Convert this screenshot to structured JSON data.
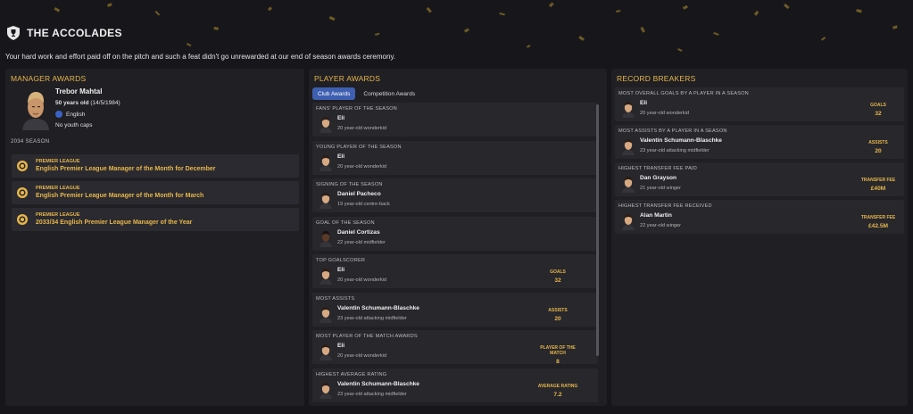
{
  "header": {
    "title": "THE ACCOLADES",
    "subtitle": "Your hard work and effort paid off on the pitch and such a feat didn't go unrewarded at our end of season awards ceremony."
  },
  "manager_awards": {
    "title": "MANAGER AWARDS",
    "name": "Trebor Mahtal",
    "age": "50 years old",
    "dob": "(14/5/1984)",
    "nationality": "English",
    "caps": "No youth caps",
    "season": "2034 SEASON",
    "awards": [
      {
        "competition": "PREMIER LEAGUE",
        "name": "English Premier League Manager of the Month for December"
      },
      {
        "competition": "PREMIER LEAGUE",
        "name": "English Premier League Manager of the Month for March"
      },
      {
        "competition": "PREMIER LEAGUE",
        "name": "2033/34 English Premier League Manager of the Year"
      }
    ]
  },
  "player_awards": {
    "title": "PLAYER AWARDS",
    "tabs": [
      "Club Awards",
      "Competition Awards"
    ],
    "items": [
      {
        "category": "FANS' PLAYER OF THE SEASON",
        "player": "Eli",
        "desc": "20 year-old wonderkid",
        "stat_label": "",
        "stat_value": ""
      },
      {
        "category": "YOUNG PLAYER OF THE SEASON",
        "player": "Eli",
        "desc": "20 year-old wonderkid",
        "stat_label": "",
        "stat_value": ""
      },
      {
        "category": "SIGNING OF THE SEASON",
        "player": "Daniel Pacheco",
        "desc": "19 year-old centre-back",
        "stat_label": "",
        "stat_value": ""
      },
      {
        "category": "GOAL OF THE SEASON",
        "player": "Daniel Cortizas",
        "desc": "22 year-old midfielder",
        "stat_label": "",
        "stat_value": ""
      },
      {
        "category": "TOP GOALSCORER",
        "player": "Eli",
        "desc": "20 year-old wonderkid",
        "stat_label": "GOALS",
        "stat_value": "32"
      },
      {
        "category": "MOST ASSISTS",
        "player": "Valentin Schumann-Blaschke",
        "desc": "23 year-old attacking midfielder",
        "stat_label": "ASSISTS",
        "stat_value": "20"
      },
      {
        "category": "MOST PLAYER OF THE MATCH AWARDS",
        "player": "Eli",
        "desc": "20 year-old wonderkid",
        "stat_label": "PLAYER OF THE MATCH",
        "stat_value": "8"
      },
      {
        "category": "HIGHEST AVERAGE RATING",
        "player": "Valentin Schumann-Blaschke",
        "desc": "23 year-old attacking midfielder",
        "stat_label": "AVERAGE RATING",
        "stat_value": "7.2"
      }
    ]
  },
  "record_breakers": {
    "title": "RECORD BREAKERS",
    "items": [
      {
        "category": "MOST OVERALL GOALS BY A PLAYER IN A SEASON",
        "player": "Eli",
        "desc": "20 year-old wonderkid",
        "stat_label": "GOALS",
        "stat_value": "32"
      },
      {
        "category": "MOST ASSISTS BY A PLAYER IN A SEASON",
        "player": "Valentin Schumann-Blaschke",
        "desc": "23 year-old attacking midfielder",
        "stat_label": "ASSISTS",
        "stat_value": "20"
      },
      {
        "category": "HIGHEST TRANSFER FEE PAID",
        "player": "Dan Grayson",
        "desc": "21 year-old winger",
        "stat_label": "TRANSFER FEE",
        "stat_value": "£40M"
      },
      {
        "category": "HIGHEST TRANSFER FEE RECEIVED",
        "player": "Alan Martin",
        "desc": "22 year-old winger",
        "stat_label": "TRANSFER FEE",
        "stat_value": "£42.5M"
      }
    ]
  },
  "colors": {
    "accent": "#e8b64a",
    "tab_active": "#3e5fb0",
    "panel": "#1f1f24",
    "card": "#27272c",
    "background": "#17171b"
  },
  "icons": {
    "header": "shield-trophy-icon",
    "award": "medal-icon",
    "nationality": "flag-icon",
    "player": "player-face-icon"
  }
}
